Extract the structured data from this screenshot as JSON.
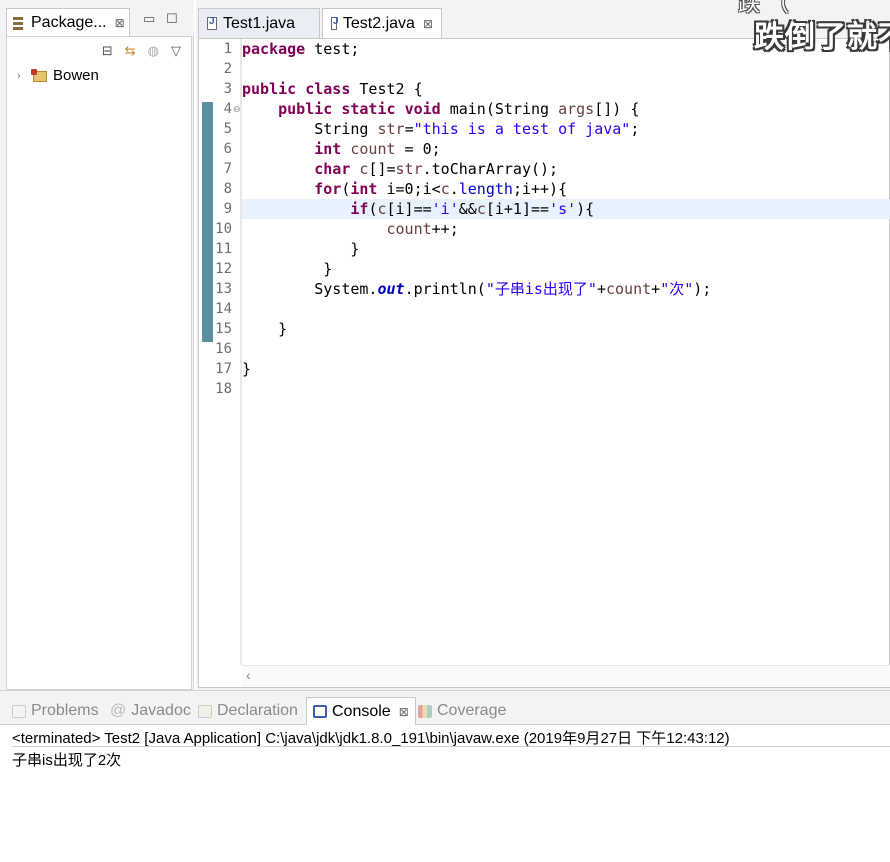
{
  "package_explorer": {
    "tab_label": "Package...",
    "close_glyph": "⊠",
    "minimize_glyph": "▭",
    "maximize_glyph": "☐",
    "toolbar_icons": [
      "collapse-all-icon",
      "link-with-editor-icon",
      "focus-icon",
      "view-menu-icon"
    ],
    "tree": [
      {
        "label": "Bowen",
        "expand_glyph": "›"
      }
    ]
  },
  "editor": {
    "tabs": [
      {
        "label": "Test1.java",
        "active": false
      },
      {
        "label": "Test2.java",
        "active": true
      }
    ],
    "close_glyph": "⊠",
    "line_numbers": [
      "1",
      "2",
      "3",
      "4",
      "5",
      "6",
      "7",
      "8",
      "9",
      "10",
      "11",
      "12",
      "13",
      "14",
      "15",
      "16",
      "17",
      "18"
    ],
    "fold_glyph": "⊖",
    "highlighted_line": 9,
    "lines": {
      "l1": {
        "kw": "package",
        "rest": " test;"
      },
      "l3": {
        "kw1": "public",
        "kw2": "class",
        "rest": " Test2 {"
      },
      "l4": {
        "kw1": "public",
        "kw2": "static",
        "kw3": "void",
        "mid": " main(String ",
        "param": "args",
        "end": "[]) {"
      },
      "l5": {
        "pre": "String ",
        "var": "str",
        "eq": "=",
        "str": "\"this is a test of java\"",
        "end": ";"
      },
      "l6": {
        "kw": "int",
        "var": "count",
        "end": " = 0;"
      },
      "l7": {
        "kw": "char",
        "var": "c",
        "mid": "[]=",
        "var2": "str",
        "end": ".toCharArray();"
      },
      "l8": {
        "kw": "for",
        "open": "(",
        "kw2": "int",
        "a": " i=0;i<",
        "var": "c",
        "dot": ".",
        "fld": "length",
        "end": ";i++){"
      },
      "l9": {
        "kw": "if",
        "a": "(",
        "v1": "c",
        "b": "[i]==",
        "s1": "'i'",
        "c": "&&",
        "v2": "c",
        "d": "[i+1]==",
        "s2": "'s'",
        "e": "){"
      },
      "l10": {
        "var": "count",
        "end": "++;"
      },
      "l11": {
        "text": "}"
      },
      "l12": {
        "text": "}"
      },
      "l13": {
        "pre": "System.",
        "sfld": "out",
        "mid": ".println(",
        "s1": "\"子串is出现了\"",
        "plus1": "+",
        "var": "count",
        "plus2": "+",
        "s2": "\"次\"",
        "end": ");"
      },
      "l15": {
        "text": "}"
      },
      "l17": {
        "text": "}"
      }
    },
    "scroll_left_glyph": "‹"
  },
  "overlay_caption": {
    "main": "跌倒了就不",
    "top": "跌  （"
  },
  "bottom_panel": {
    "tabs": [
      {
        "label": "Problems",
        "icon": "problems-icon",
        "color": "#c9c9c9"
      },
      {
        "label": "Javadoc",
        "icon": "javadoc-icon",
        "color": "#c9c9c9"
      },
      {
        "label": "Declaration",
        "icon": "declaration-icon",
        "color": "#c9c9c9"
      },
      {
        "label": "Console",
        "icon": "console-icon",
        "color": "#3a5da8",
        "active": true
      },
      {
        "label": "Coverage",
        "icon": "coverage-icon",
        "color": "#c9c9c9"
      }
    ],
    "close_glyph": "⊠",
    "console_status": "<terminated> Test2 [Java Application] C:\\java\\jdk\\jdk1.8.0_191\\bin\\javaw.exe (2019年9月27日 下午12:43:12)",
    "console_output": "子串is出现了2次"
  },
  "colors": {
    "keyword": "#7f0055",
    "string": "#2a00ff",
    "field": "#0000c0",
    "local_var": "#6a3e3e",
    "current_line": "#e8f2fe",
    "change_bar": "#5a8fa0"
  }
}
